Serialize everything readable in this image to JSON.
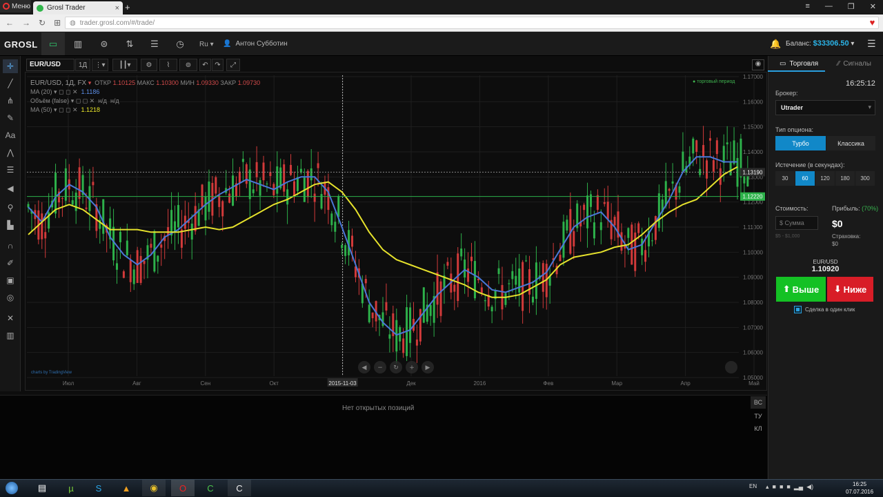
{
  "browser": {
    "menu_label": "Меню",
    "tab_title": "Grosl Trader",
    "url": "trader.grosl.com/#/trade/"
  },
  "header": {
    "logo": "GROSL",
    "lang": "Ru",
    "user_name": "Антон Субботин",
    "balance_label": "Баланс:",
    "balance_value": "$33306.50",
    "nav_icons": [
      "monitor-icon",
      "bar-chart-icon",
      "dollar-icon",
      "sort-arrows-icon",
      "sliders-icon",
      "clock-icon"
    ]
  },
  "chart_toolbar": {
    "symbol": "EUR/USD",
    "timeframe": "1Д"
  },
  "chart_info": {
    "title": "EUR/USD, 1Д, FX",
    "open_label": "ОТКР",
    "open_value": "1.10125",
    "high_label": "МАКС",
    "high_value": "1.10300",
    "low_label": "МИН",
    "low_value": "1.09330",
    "close_label": "ЗАКР",
    "close_value": "1.09730",
    "ma20_label": "MA (20)",
    "ma20_value": "1.1186",
    "volume_label": "Объём (false)",
    "volume_value_1": "н/д",
    "volume_value_2": "н/д",
    "ma50_label": "MA (50)",
    "ma50_value": "1.1218",
    "trading_period": "торговый период",
    "watermark": "charts by TradingView",
    "crosshair_date": "2015-11-03"
  },
  "chart_data": {
    "type": "line",
    "x": [
      "Июл",
      "Авг",
      "Сен",
      "Окт",
      "2015-11-03",
      "Дек",
      "2016",
      "Фев",
      "Мар",
      "Апр",
      "Май"
    ],
    "y_ticks": [
      "1.17000",
      "1.16000",
      "1.15000",
      "1.14000",
      "1.13000",
      "1.12000",
      "1.11000",
      "1.10000",
      "1.09000",
      "1.08000",
      "1.07000",
      "1.06000",
      "1.05000"
    ],
    "ylim": [
      1.05,
      1.17
    ],
    "series": [
      {
        "name": "MA (20)",
        "color": "#4a78d8",
        "values": [
          1.118,
          1.112,
          1.122,
          1.127,
          1.124,
          1.118,
          1.106,
          1.099,
          1.095,
          1.099,
          1.106,
          1.109,
          1.114,
          1.119,
          1.123,
          1.126,
          1.129,
          1.127,
          1.125,
          1.128,
          1.13,
          1.13,
          1.124,
          1.11,
          1.095,
          1.08,
          1.072,
          1.067,
          1.069,
          1.076,
          1.083,
          1.088,
          1.093,
          1.09,
          1.085,
          1.084,
          1.086,
          1.088,
          1.092,
          1.101,
          1.11,
          1.114,
          1.116,
          1.11,
          1.101,
          1.103,
          1.112,
          1.121,
          1.132,
          1.138,
          1.138,
          1.136,
          1.136
        ]
      },
      {
        "name": "MA (50)",
        "color": "#e6e22c",
        "values": [
          1.107,
          1.112,
          1.117,
          1.119,
          1.117,
          1.113,
          1.109,
          1.109,
          1.109,
          1.108,
          1.108,
          1.108,
          1.109,
          1.11,
          1.109,
          1.11,
          1.113,
          1.116,
          1.119,
          1.121,
          1.124,
          1.127,
          1.128,
          1.124,
          1.117,
          1.108,
          1.101,
          1.097,
          1.095,
          1.093,
          1.091,
          1.089,
          1.087,
          1.084,
          1.082,
          1.082,
          1.083,
          1.086,
          1.089,
          1.095,
          1.098,
          1.099,
          1.1,
          1.102,
          1.103,
          1.107,
          1.112,
          1.116,
          1.119,
          1.121,
          1.126,
          1.131,
          1.134
        ]
      }
    ],
    "price_labels": [
      {
        "value": 1.1319,
        "text": "1.13190"
      },
      {
        "value": 1.1222,
        "text": "1.12220"
      }
    ],
    "grid": true
  },
  "positions": {
    "empty_text": "Нет открытых позиций",
    "tabs": [
      "ВС",
      "ТУ",
      "КЛ"
    ]
  },
  "panel": {
    "tab_trade": "Торговля",
    "tab_signals": "Сигналы",
    "time": "16:25:12",
    "broker_label": "Брокер:",
    "broker_value": "Utrader",
    "option_type_label": "Тип опциона:",
    "option_turbo": "Турбо",
    "option_classic": "Классика",
    "expiry_label": "Истечение (в секундах):",
    "expiry_options": [
      "30",
      "60",
      "120",
      "180",
      "300"
    ],
    "cost_label": "Стоимость:",
    "amount_placeholder": "$ Сумма",
    "amount_range": "$5 - $1,000",
    "profit_label": "Прибыль:",
    "profit_pct": "(70%)",
    "profit_value": "$0",
    "insurance_label": "Страховка:",
    "insurance_value": "$0",
    "pair": "EUR/USD",
    "price": "1.10920",
    "up_label": "Выше",
    "down_label": "Ниже",
    "one_click_label": "Сделка в один клик"
  },
  "taskbar": {
    "lang": "EN",
    "time": "16:25",
    "date": "07.07.2016"
  },
  "colors": {
    "accent": "#1188c8",
    "up": "#14c124",
    "down": "#d81d27",
    "balance": "#2bb4e8"
  }
}
